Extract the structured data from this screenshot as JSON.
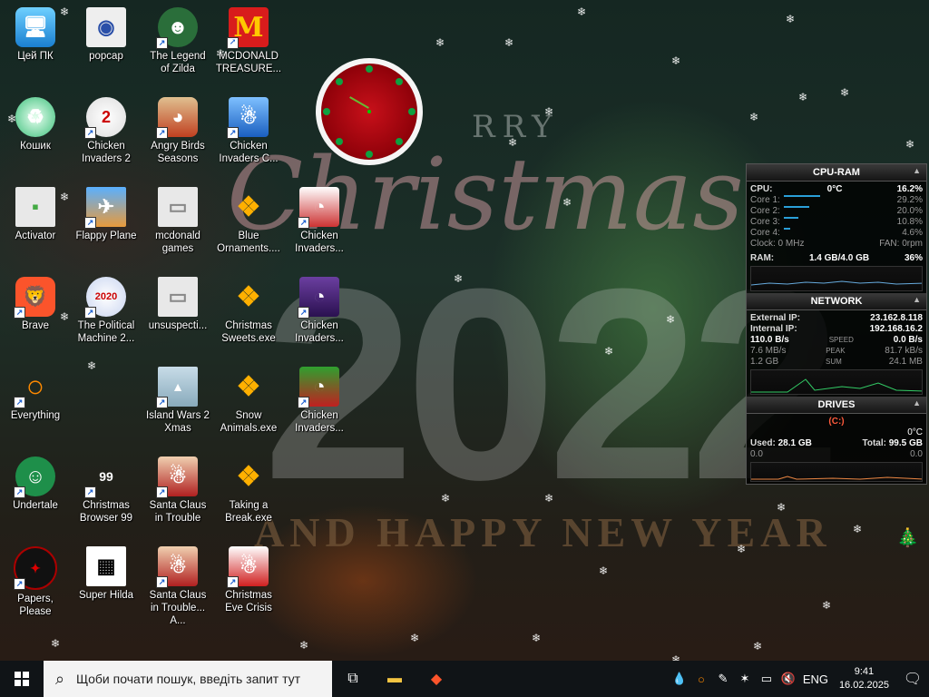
{
  "desktop": {
    "icons": [
      {
        "label": "Цей ПК",
        "icon": "computer-icon"
      },
      {
        "label": "popcap",
        "icon": "folder-icon"
      },
      {
        "label": "The Legend of Zilda",
        "icon": "game-icon"
      },
      {
        "label": "MCDONALD TREASURE...",
        "icon": "mcdonalds-icon"
      },
      {
        "label": "Кошик",
        "icon": "recycle-bin-icon"
      },
      {
        "label": "Chicken Invaders 2",
        "icon": "chicken-icon"
      },
      {
        "label": "Angry Birds Seasons",
        "icon": "angry-birds-icon"
      },
      {
        "label": "Chicken Invaders C...",
        "icon": "chicken-icon"
      },
      {
        "label": "Activator",
        "icon": "file-icon"
      },
      {
        "label": "Flappy Plane",
        "icon": "game-icon"
      },
      {
        "label": "mcdonald games",
        "icon": "file-icon"
      },
      {
        "label": "Blue Ornaments....",
        "icon": "exe-icon"
      },
      {
        "label": "Chicken Invaders...",
        "icon": "chicken-icon"
      },
      {
        "label": "Brave",
        "icon": "brave-icon"
      },
      {
        "label": "The Political Machine 2...",
        "icon": "game-icon"
      },
      {
        "label": "unsuspecti...",
        "icon": "file-icon"
      },
      {
        "label": "Christmas Sweets.exe",
        "icon": "exe-icon"
      },
      {
        "label": "Chicken Invaders...",
        "icon": "chicken-icon"
      },
      {
        "label": "Everything",
        "icon": "search-icon"
      },
      {
        "label": "Island Wars 2 Xmas",
        "icon": "game-icon"
      },
      {
        "label": "Snow Animals.exe",
        "icon": "exe-icon"
      },
      {
        "label": "Chicken Invaders...",
        "icon": "chicken-icon"
      },
      {
        "label": "Undertale",
        "icon": "game-icon"
      },
      {
        "label": "Christmas Browser 99",
        "icon": "tree-icon"
      },
      {
        "label": "Santa Claus in Trouble",
        "icon": "santa-icon"
      },
      {
        "label": "Taking a Break.exe",
        "icon": "exe-icon"
      },
      {
        "label": "Papers, Please",
        "icon": "game-icon"
      },
      {
        "label": "Super Hilda",
        "icon": "game-icon"
      },
      {
        "label": "Santa Claus in Trouble... A...",
        "icon": "santa-icon"
      },
      {
        "label": "Christmas Eve Crisis",
        "icon": "santa-icon"
      }
    ],
    "badges": {
      "chicken2": "2",
      "political": "2020",
      "browser": "99"
    }
  },
  "wallpaper": {
    "merry": "RRY",
    "christmas": "Christmas",
    "year": "2022",
    "greeting": "AND HAPPY NEW YEAR"
  },
  "sysmon": {
    "cpu_ram": {
      "title": "CPU-RAM",
      "cpu_label": "CPU:",
      "cpu_temp": "0°C",
      "cpu_usage": "16.2%",
      "cores": [
        {
          "label": "Core 1:",
          "value": "29.2%"
        },
        {
          "label": "Core 2:",
          "value": "20.0%"
        },
        {
          "label": "Core 3:",
          "value": "10.8%"
        },
        {
          "label": "Core 4:",
          "value": "4.6%"
        }
      ],
      "clock": "Clock: 0 MHz",
      "fan": "FAN: 0rpm",
      "ram_label": "RAM:",
      "ram_used": "1.4 GB/4.0 GB",
      "ram_pct": "36%"
    },
    "network": {
      "title": "NETWORK",
      "external_label": "External IP:",
      "external_ip": "23.162.8.118",
      "internal_label": "Internal IP:",
      "internal_ip": "192.168.16.2",
      "speed_left": "110.0 B/s",
      "speed_label": "SPEED",
      "speed_right": "0.0 B/s",
      "peak_left": "7.6 MB/s",
      "peak_label": "PEAK",
      "peak_right": "81.7 kB/s",
      "sum_left": "1.2 GB",
      "sum_label": "SUM",
      "sum_right": "24.1 MB"
    },
    "drives": {
      "title": "DRIVES",
      "drive": "(C:)",
      "temp": "0°C",
      "used_label": "Used:",
      "used": "28.1 GB",
      "total_label": "Total:",
      "total": "99.5 GB",
      "read": "0.0",
      "write": "0.0"
    }
  },
  "taskbar": {
    "search_placeholder": "Щоби почати пошук, введіть запит тут",
    "language": "ENG",
    "time": "9:41",
    "date": "16.02.2025"
  }
}
